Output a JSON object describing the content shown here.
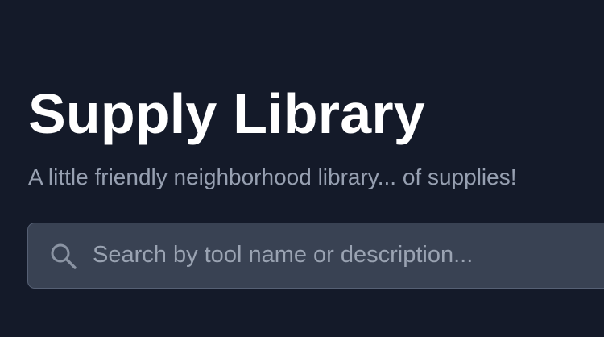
{
  "header": {
    "title": "Supply Library",
    "subtitle": "A little friendly neighborhood library... of supplies!"
  },
  "search": {
    "placeholder": "Search by tool name or description...",
    "value": "",
    "icon": "search-icon"
  },
  "colors": {
    "background": "#141a29",
    "title": "#ffffff",
    "subtitle": "#97a0b1",
    "search_background": "#394253",
    "search_border": "#566074",
    "placeholder": "#9aa3b2"
  }
}
